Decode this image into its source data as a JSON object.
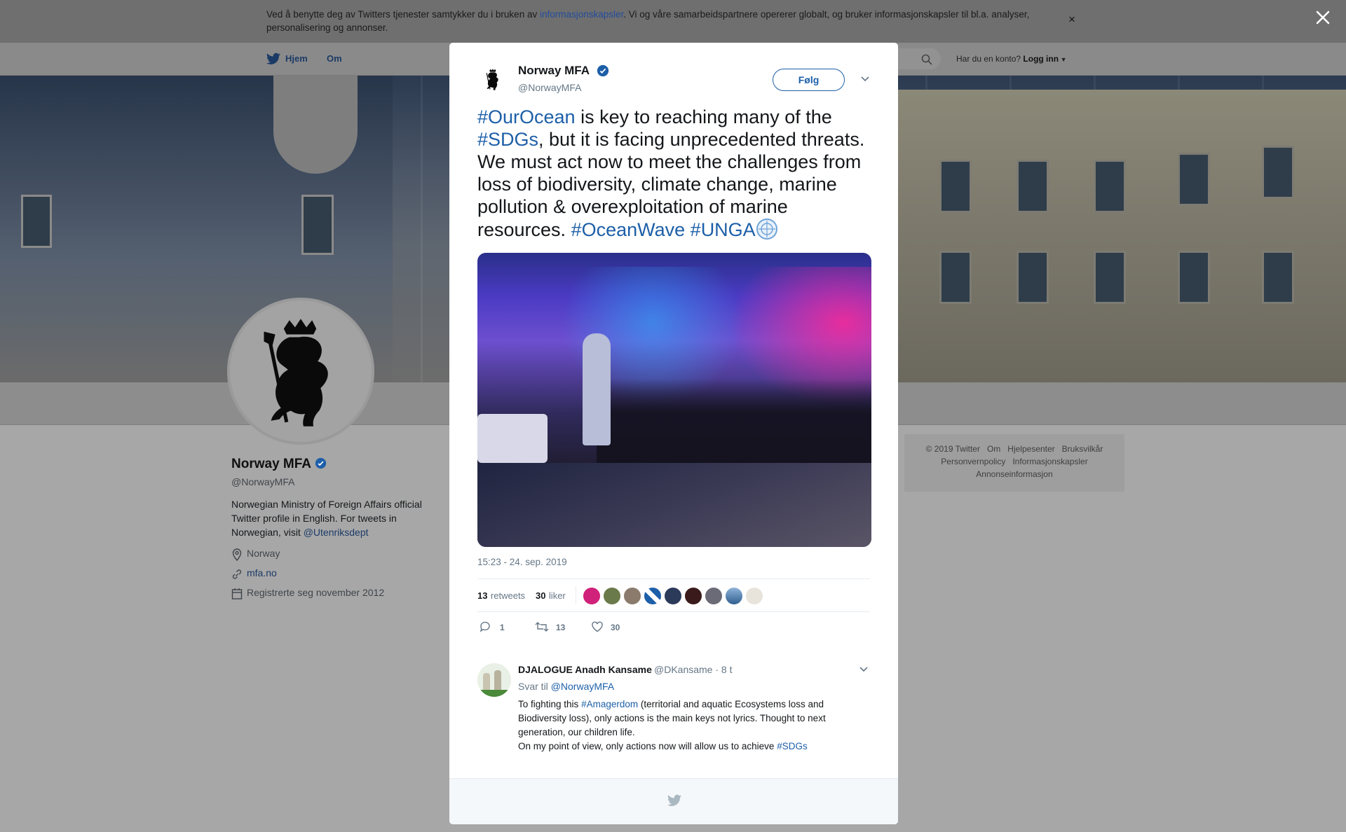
{
  "cookie_banner": {
    "text_before": "Ved å benytte deg av Twitters tjenester samtykker du i bruken av ",
    "link": "informasjonskapsler",
    "text_after": ". Vi og våre samarbeidspartnere opererer globalt, og bruker informasjonskapsler til bl.a. analyser, personalisering og annonser.",
    "close_symbol": "×"
  },
  "nav": {
    "home": "Hjem",
    "about": "Om",
    "account_prompt": "Har du en konto?",
    "login": "Logg inn"
  },
  "profile": {
    "name": "Norway MFA",
    "handle": "@NorwayMFA",
    "bio": "Norwegian Ministry of Foreign Affairs official Twitter profile in English. For tweets in Norwegian, visit ",
    "bio_link": "@Utenriksdept",
    "location": "Norway",
    "website": "mfa.no",
    "joined": "Registrerte seg november 2012"
  },
  "footer": {
    "links": [
      "© 2019 Twitter",
      "Om",
      "Hjelpesenter",
      "Bruksvilkår",
      "Personvernpolicy",
      "Informasjonskapsler",
      "Annonseinformasjon"
    ]
  },
  "tweet": {
    "author_name": "Norway MFA",
    "author_handle": "@NorwayMFA",
    "follow_label": "Følg",
    "text": {
      "tag1": "#OurOcean",
      "part1": " is key to reaching many of the ",
      "tag2": "#SDGs",
      "part2": ", but it is facing unprecedented threats. We must act now to meet the challenges from loss of biodiversity, climate change, marine pollution & overexploitation of marine resources. ",
      "tag3": "#OceanWave",
      "tag4": "#UNGA"
    },
    "timestamp": "15:23 - 24. sep. 2019",
    "retweets_count": "13",
    "retweets_label": "retweets",
    "likes_count": "30",
    "likes_label": "liker",
    "actions": {
      "reply_count": "1",
      "retweet_count": "13",
      "like_count": "30"
    },
    "accent_color": "#1d5fa8"
  },
  "reply": {
    "name": "DJALOGUE Anadh Kansame",
    "handle_time": "@DKansame · 8 t",
    "reply_to_label": "Svar til ",
    "reply_to_handle": "@NorwayMFA",
    "text_before": "To fighting this ",
    "tag1": "#Amagerdom",
    "text_mid": " (territorial and aquatic Ecosystems loss and Biodiversity loss), only actions is the main keys not lyrics. Thought to next generation, our children life.",
    "text_line2": "On my point of view, only actions now will allow us to achieve ",
    "tag2": "#SDGs"
  }
}
